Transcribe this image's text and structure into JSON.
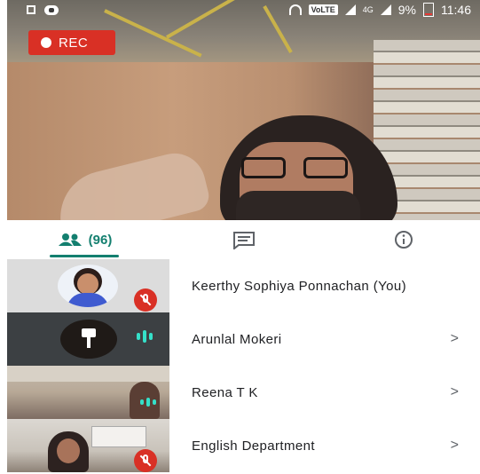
{
  "status_bar": {
    "volte": "VoLTE",
    "network": "4G",
    "battery": "9%",
    "time": "11:46"
  },
  "recording": {
    "label": "REC"
  },
  "tabs": {
    "people_count": "(96)",
    "chat_icon": "chat-icon",
    "info_icon": "info-icon"
  },
  "participants": [
    {
      "name": "Keerthy Sophiya Ponnachan (You)",
      "mic": "muted"
    },
    {
      "name": "Arunlal Mokeri",
      "mic": "speaking"
    },
    {
      "name": "Reena T K",
      "mic": "speaking"
    },
    {
      "name": "English Department",
      "mic": "muted"
    }
  ],
  "colors": {
    "accent": "#137f6f",
    "rec": "#d93025",
    "speaking": "#35e0c9"
  }
}
